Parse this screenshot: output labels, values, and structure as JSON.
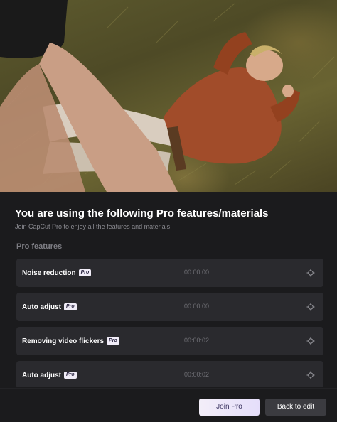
{
  "dialog": {
    "title": "You are using the following Pro features/materials",
    "subtitle": "Join CapCut Pro to enjoy all the features and materials",
    "section_label": "Pro features"
  },
  "features": [
    {
      "name": "Noise reduction",
      "badge": "Pro",
      "time": "00:00:00"
    },
    {
      "name": "Auto adjust",
      "badge": "Pro",
      "time": "00:00:00"
    },
    {
      "name": "Removing video flickers",
      "badge": "Pro",
      "time": "00:00:02"
    },
    {
      "name": "Auto adjust",
      "badge": "Pro",
      "time": "00:00:02"
    }
  ],
  "buttons": {
    "join_pro": "Join Pro",
    "back_to_edit": "Back to edit"
  },
  "icons": {
    "locate": "target-icon"
  },
  "colors": {
    "panel_bg": "#1b1b1d",
    "row_bg": "#2a2a2e",
    "pro_badge_bg": "#f1edf8",
    "join_button_bg": "#ede6fa",
    "back_button_bg": "#3b3b40"
  }
}
